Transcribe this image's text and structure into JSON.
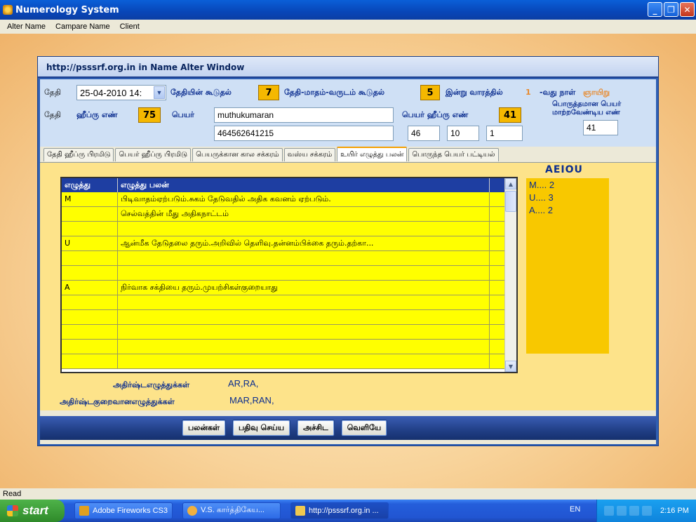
{
  "app": {
    "title": "Numerology System",
    "menu": [
      "Alter Name",
      "Campare Name",
      "Client"
    ],
    "status": "Read"
  },
  "window": {
    "title": "http://psssrf.org.in    in   Name Alter Window"
  },
  "form": {
    "date_label": "தேதி",
    "date_value": "25-04-2010 14:",
    "date_sum_label": "தேதியின் கூடுதல்",
    "date_sum_value": "7",
    "dmy_sum_label": "தேதி-மாதம்-வருடம் கூடுதல்",
    "dmy_sum_value": "5",
    "weekday_label": "இன்று வாரத்தில்",
    "weekday_number": "1",
    "day_label": "-வது நாள்",
    "day_name": "ஞாயிறு",
    "date_hebrew_label": "தேதி",
    "hebrew_number_label": "ஹீப்ரு எண்",
    "hebrew_number_value": "75",
    "name_label": "பெயர்",
    "name_value": "muthukumaran",
    "number_string": "464562641215",
    "name_hebrew_label": "பெயர் ஹீப்ரு எண்",
    "name_hebrew_value": "41",
    "num_a": "46",
    "num_b": "10",
    "num_c": "1",
    "suitable_label_1": "பொருத்தமான பெயர்",
    "suitable_label_2": "மாற்றவேண்டிய எண்",
    "suitable_value": "41"
  },
  "tabs": [
    {
      "label": "தேதி ஹீப்ரு பிரமிடு",
      "active": false
    },
    {
      "label": "பெயர் ஹீப்ரு பிரமிடு",
      "active": false
    },
    {
      "label": "பெயருக்கான கால சக்கரம்",
      "active": false
    },
    {
      "label": "வஸ்ய சக்கரம்",
      "active": false
    },
    {
      "label": "உயிர் எழுத்து பலன்",
      "active": true
    },
    {
      "label": "பொருந்த பெயர் பட்டியல்",
      "active": false
    }
  ],
  "grid": {
    "headers": [
      "எழுத்து",
      "எழுத்து பலன்"
    ],
    "rows": [
      [
        "M",
        "பிடிவாதம்ஏற்படும்.சுகம் தேடுவதில் அதிக கவனம் ஏற்படும்."
      ],
      [
        "",
        "செல்வத்தின் மீது அதிகநாட்டம்"
      ],
      [
        "",
        ""
      ],
      [
        "U",
        "ஆன்மீக தேடுதலை தரும்.அறிவில் தெளிவு.தன்னம்பிக்கை தரும்.தற்கா..."
      ],
      [
        "",
        ""
      ],
      [
        "",
        ""
      ],
      [
        "A",
        "நிர்வாக சக்தியை தரும்.முயற்சிகள்குறையாது"
      ],
      [
        "",
        ""
      ],
      [
        "",
        ""
      ],
      [
        "",
        ""
      ],
      [
        "",
        ""
      ],
      [
        "",
        ""
      ]
    ]
  },
  "vowels": {
    "title": "AEIOU",
    "items": [
      "M.... 2",
      "U.... 3",
      "A.... 2"
    ]
  },
  "lucky": {
    "lucky_label": "அதிர்ஷ்டஎழுத்துக்கள்",
    "lucky_value": "AR,RA,",
    "less_lucky_label": "அதிர்ஷ்டகுறைவானஎழுத்துக்கள்",
    "less_lucky_value": "MAR,RAN,"
  },
  "buttons": {
    "results": "பலன்கள்",
    "save": "பதிவு செய்ய",
    "print": "அச்சிட",
    "exit": "வெளியே"
  },
  "taskbar": {
    "start": "start",
    "items": [
      "Adobe Fireworks CS3",
      "V.S. கார்த்திகேய...",
      "http://psssrf.org.in ..."
    ],
    "lang": "EN",
    "clock": "2:16 PM"
  }
}
